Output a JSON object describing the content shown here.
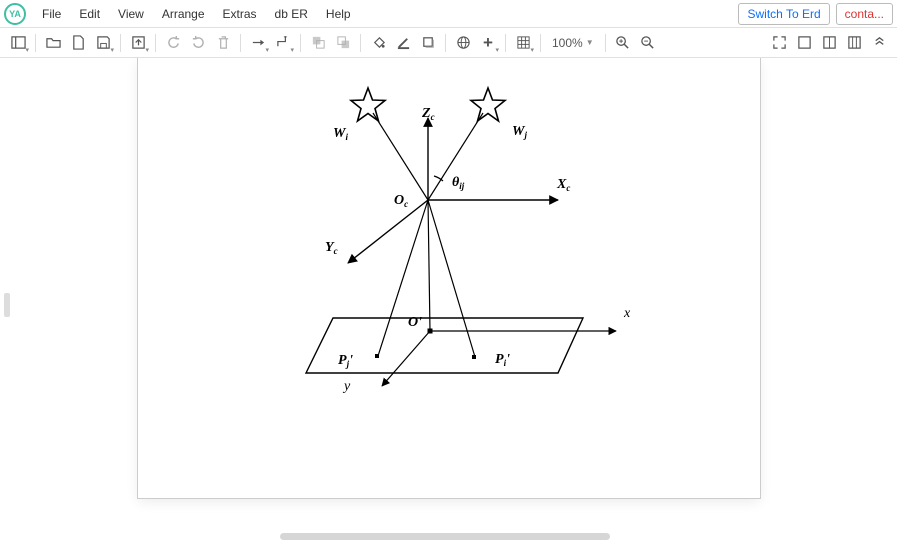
{
  "app": {
    "logo_text": "YA"
  },
  "menu": {
    "file": "File",
    "edit": "Edit",
    "view": "View",
    "arrange": "Arrange",
    "extras": "Extras",
    "db_er": "db ER",
    "help": "Help"
  },
  "top_buttons": {
    "switch": "Switch To Erd",
    "contact": "conta..."
  },
  "toolbar": {
    "zoom": "100%"
  },
  "diagram": {
    "labels": {
      "Zc_base": "Z",
      "Zc_sub": "c",
      "Xc_base": "X",
      "Xc_sub": "c",
      "Yc_base": "Y",
      "Yc_sub": "c",
      "Oc_base": "O",
      "Oc_sub": "c",
      "theta_base": "θ",
      "theta_sub": "ij",
      "Wi_base": "W",
      "Wi_sub": "i",
      "Wj_base": "W",
      "Wj_sub": "j",
      "Oprime": "O'",
      "x": "x",
      "y": "y",
      "Pi_base": "P",
      "Pi_sub": "i",
      "Pi_prime": "'",
      "Pj_base": "P",
      "Pj_sub": "j",
      "Pj_prime": "'"
    }
  }
}
